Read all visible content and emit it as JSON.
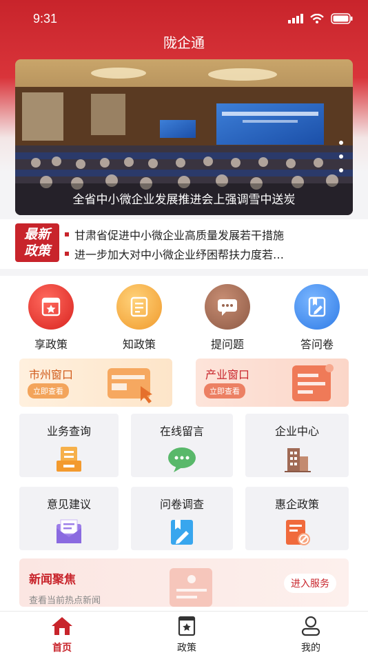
{
  "status": {
    "time": "9:31"
  },
  "app": {
    "title": "陇企通"
  },
  "banner": {
    "caption": "全省中小微企业发展推进会上强调雪中送炭"
  },
  "policy": {
    "badge_line1": "最新",
    "badge_line2": "政策",
    "items": [
      {
        "text": "甘肃省促进中小微企业高质量发展若干措施"
      },
      {
        "text": "进一步加大对中小微企业纾困帮扶力度若…"
      }
    ]
  },
  "quick": [
    {
      "label": "享政策",
      "icon": "policy-star-icon",
      "color": "#e23a36"
    },
    {
      "label": "知政策",
      "icon": "document-icon",
      "color": "#f2a23c"
    },
    {
      "label": "提问题",
      "icon": "chat-icon",
      "color": "#a46a52"
    },
    {
      "label": "答问卷",
      "icon": "questionnaire-icon",
      "color": "#3e8ef0"
    }
  ],
  "windows": [
    {
      "title": "市州窗口",
      "button": "立即查看"
    },
    {
      "title": "产业窗口",
      "button": "立即查看"
    }
  ],
  "services": [
    {
      "label": "业务查询",
      "icon": "inquiry-icon"
    },
    {
      "label": "在线留言",
      "icon": "message-bubble-icon"
    },
    {
      "label": "企业中心",
      "icon": "building-icon"
    },
    {
      "label": "意见建议",
      "icon": "envelope-icon"
    },
    {
      "label": "问卷调查",
      "icon": "survey-icon"
    },
    {
      "label": "惠企政策",
      "icon": "policy-doc-icon"
    }
  ],
  "news": {
    "title": "新闻聚焦",
    "subtitle": "查看当前热点新闻",
    "button": "进入服务"
  },
  "tabs": [
    {
      "label": "首页",
      "icon": "home-icon",
      "active": true
    },
    {
      "label": "政策",
      "icon": "policy-tab-icon",
      "active": false
    },
    {
      "label": "我的",
      "icon": "profile-icon",
      "active": false
    }
  ],
  "colors": {
    "brand": "#c8242b",
    "accent_orange": "#f08a3c"
  }
}
